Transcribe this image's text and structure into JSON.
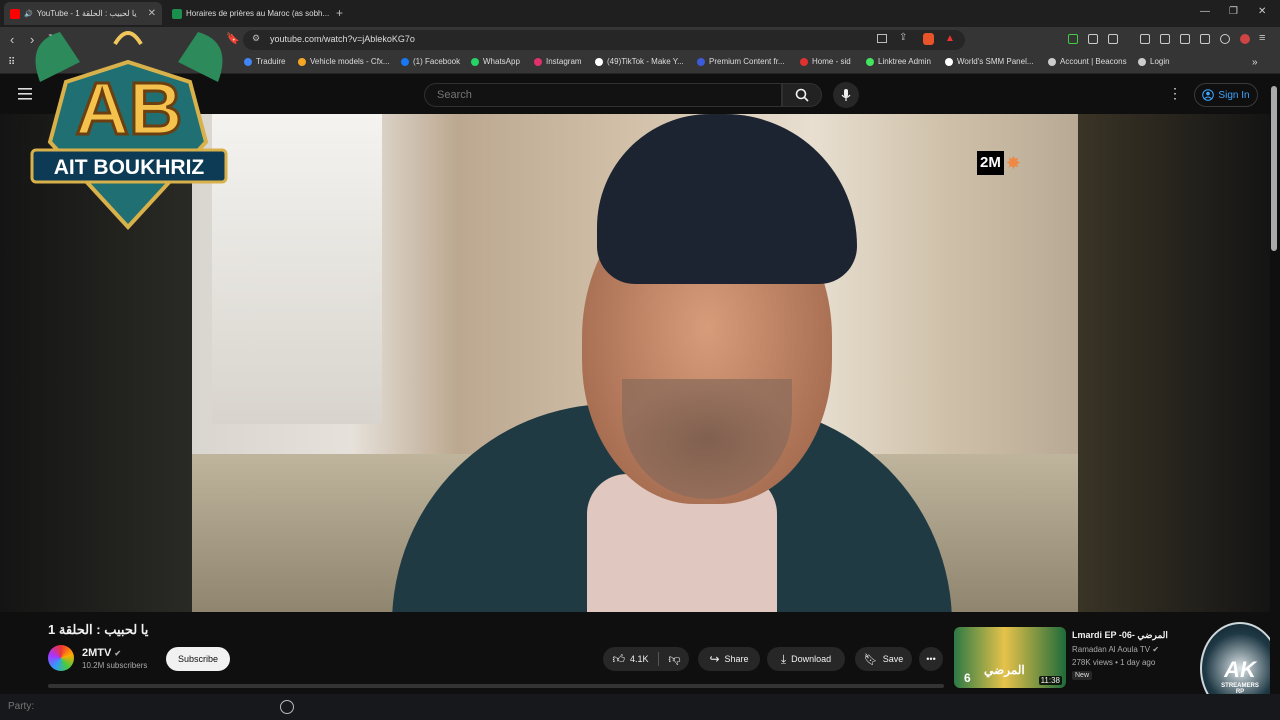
{
  "browser": {
    "tabs": [
      {
        "title": "YouTube - يا لحبيب : الحلقة 1",
        "active": true,
        "favicon_color": "#ff0000"
      },
      {
        "title": "Horaires de prières au Maroc (as sobh...",
        "active": false,
        "favicon_color": "#1b8f4e"
      }
    ],
    "url": "youtube.com/watch?v=jAblekoKG7o",
    "bookmarks": [
      {
        "label": "Traduire",
        "icon_color": "#4285f4"
      },
      {
        "label": "Vehicle models - Cfx...",
        "icon_color": "#f5a623"
      },
      {
        "label": "(1) Facebook",
        "icon_color": "#1877f2"
      },
      {
        "label": "WhatsApp",
        "icon_color": "#25d366"
      },
      {
        "label": "Instagram",
        "icon_color": "#e1306c"
      },
      {
        "label": "(49)TikTok - Make Y...",
        "icon_color": "#ffffff"
      },
      {
        "label": "Premium Content fr...",
        "icon_color": "#3b5bdb"
      },
      {
        "label": "Home - sid",
        "icon_color": "#e03131"
      },
      {
        "label": "Linktree Admin",
        "icon_color": "#43e55e"
      },
      {
        "label": "World's SMM Panel...",
        "icon_color": "#ffffff"
      },
      {
        "label": "Account | Beacons",
        "icon_color": "#cccccc"
      },
      {
        "label": "Login",
        "icon_color": "#cccccc"
      }
    ]
  },
  "youtube": {
    "search_placeholder": "Search",
    "sign_in": "Sign In",
    "video_title": "يا لحبيب : الحلقة 1",
    "channel": {
      "name": "2MTV",
      "verified": true,
      "subscribers": "10.2M subscribers"
    },
    "subscribe": "Subscribe",
    "actions": {
      "likes": "4.1K",
      "share": "Share",
      "download": "Download",
      "save": "Save"
    },
    "recommendation": {
      "title": "Lmardi EP -06- المرضي",
      "channel": "Ramadan Al Aoula TV",
      "meta": "278K views • 1 day ago",
      "badge": "New",
      "duration": "11:38",
      "thumb_episode": "6",
      "thumb_text": "المرضي"
    },
    "video_watermark": "2M"
  },
  "overlays": {
    "ab_logo_initials": "AB",
    "ab_logo_name": "AIT BOUKHRIZ",
    "ak_logo_initials": "AK",
    "ak_logo_sub": "STREAMERS",
    "ak_logo_rp": "RP"
  },
  "party_label": "Party:"
}
